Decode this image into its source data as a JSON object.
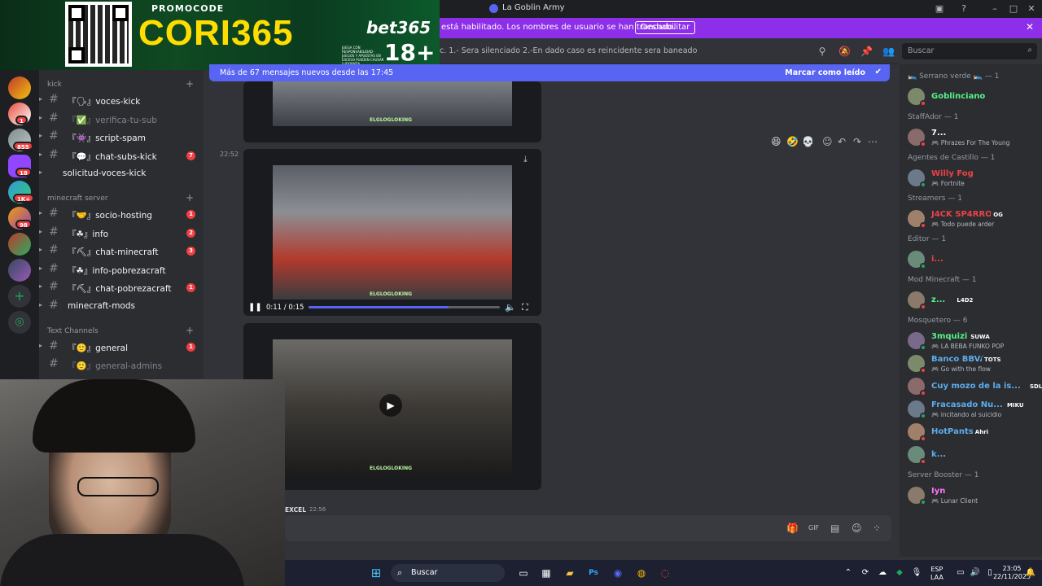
{
  "window": {
    "title": "La Goblin Army"
  },
  "notice": {
    "text": "está habilitado. Los nombres de usuario se han truncado.",
    "button": "Deshabilitar"
  },
  "promo": {
    "promocode_label": "PROMOCODE",
    "code": "CORI365",
    "brand": "bet365",
    "age": "18+",
    "small_text": "JUEGA CON RESPONSABILIDAD · JUEGOS Y APUESTAS EN EXCESO PUEDEN CAUSAR LUDOPATÍA"
  },
  "servers": {
    "badges": [
      "1",
      "855",
      "18",
      "1K+",
      "98"
    ]
  },
  "channels": {
    "category_kick": "kick",
    "kick_items": [
      {
        "label": "『🗣』voces-kick",
        "badge": ""
      },
      {
        "label": "『✅』verifica-tu-sub",
        "badge": ""
      },
      {
        "label": "『👾』script-spam",
        "badge": ""
      },
      {
        "label": "『💬』chat-subs-kick",
        "badge": "7"
      },
      {
        "label": "solicitud-voces-kick",
        "badge": ""
      }
    ],
    "category_minecraft": "minecraft server",
    "minecraft_items": [
      {
        "label": "『🤝』socio-hosting",
        "badge": "1"
      },
      {
        "label": "『☘』info",
        "badge": "2"
      },
      {
        "label": "『⛏』chat-minecraft",
        "badge": "3"
      },
      {
        "label": "『☘』info-pobrezacraft",
        "badge": ""
      },
      {
        "label": "『⛏』chat-pobrezacraft",
        "badge": "1"
      },
      {
        "label": "minecraft-mods",
        "badge": ""
      }
    ],
    "category_text": "Text Channels",
    "text_items": [
      {
        "label": "『🙂』general",
        "badge": "1"
      },
      {
        "label": "『🙂』general-admins",
        "badge": ""
      }
    ]
  },
  "header": {
    "topic": "c. 1.- Sera silenciado 2.-En dado caso es reincidente sera baneado",
    "search_placeholder": "Buscar"
  },
  "newbar": {
    "text": "Más de 67 mensajes nuevos desde las 17:45",
    "mark_read": "Marcar como leído"
  },
  "chat": {
    "timestamp_1": "22:52",
    "watermark": "ELGLOGLOKING",
    "video_time": "0:11 / 0:15",
    "video_progress": 0.73,
    "next_author": "EXCEL",
    "next_time": "22:56"
  },
  "members": {
    "groups": [
      {
        "title": "🛌 Serrano verde 🛌 — 1",
        "members": [
          {
            "name": "Goblinciano",
            "color": "#57f287",
            "activity": "",
            "tag": "",
            "status": "#f23f43"
          }
        ]
      },
      {
        "title": "StaffAdor — 1",
        "members": [
          {
            "name": "7...",
            "color": "#ffffff",
            "activity": "Phrazes For The Young",
            "tag": "",
            "status": "#f23f43"
          }
        ]
      },
      {
        "title": "Agentes de Castillo — 1",
        "members": [
          {
            "name": "Willy Fog",
            "color": "#ed4245",
            "activity": "Fortnite",
            "tag": "",
            "status": "#23a55a"
          }
        ]
      },
      {
        "title": "Streamers — 1",
        "members": [
          {
            "name": "J4CK SP4RROW",
            "color": "#ed4245",
            "activity": "Todo puede arder",
            "tag": "OG",
            "status": "#f23f43"
          }
        ]
      },
      {
        "title": "Editor — 1",
        "members": [
          {
            "name": "i...",
            "color": "#ed4245",
            "activity": "",
            "tag": "",
            "status": "#23a55a"
          }
        ]
      },
      {
        "title": "Mod Minecraft — 1",
        "members": [
          {
            "name": "z...",
            "color": "#57f287",
            "activity": "",
            "tag": "L4D2",
            "status": "#f23f43"
          }
        ]
      },
      {
        "title": "Mosquetero — 6",
        "members": [
          {
            "name": "3mquizi",
            "color": "#57f287",
            "activity": "LA BEBA FUNKO POP",
            "tag": "SUWA",
            "status": "#23a55a"
          },
          {
            "name": "Banco BBVA",
            "color": "#5dadec",
            "activity": "Go with the flow",
            "tag": "TOTS",
            "status": "#f23f43"
          },
          {
            "name": "Cuy mozo de la is...",
            "color": "#5dadec",
            "activity": "",
            "tag": "SDLG",
            "status": "#f23f43"
          },
          {
            "name": "Fracasado Nu...",
            "color": "#5dadec",
            "activity": "incitando al suicidio",
            "tag": "MIKU",
            "status": "#23a55a"
          },
          {
            "name": "HotPants",
            "color": "#5dadec",
            "activity": "",
            "tag": "Ahri",
            "status": "#f23f43"
          },
          {
            "name": "k...",
            "color": "#5dadec",
            "activity": "",
            "tag": "",
            "status": "#f23f43"
          }
        ]
      },
      {
        "title": "Server Booster — 1",
        "members": [
          {
            "name": "Iyn",
            "color": "#ff73fa",
            "activity": "Lunar Client",
            "tag": "",
            "status": "#23a55a"
          }
        ]
      }
    ]
  },
  "taskbar": {
    "search_placeholder": "Buscar",
    "lang": "ESP",
    "lang2": "LAA",
    "time": "23:05",
    "date": "22/11/2025"
  }
}
